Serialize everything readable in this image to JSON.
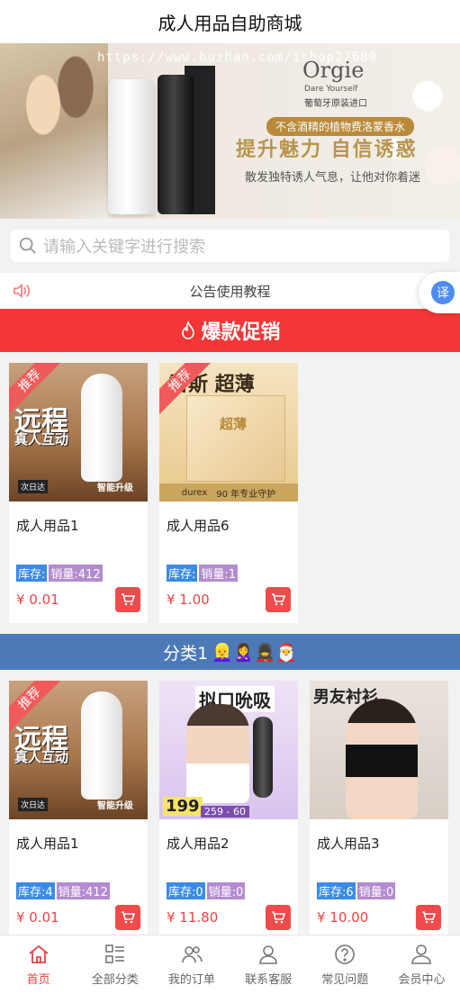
{
  "header": {
    "title": "成人用品自助商城"
  },
  "banner": {
    "watermark": "https://www.huzhan.com/ishop27680",
    "brand": "Orgie",
    "tagline": "Dare Yourself",
    "origin": "葡萄牙原装进口",
    "pill": "不含酒精的植物费洛蒙香水",
    "slogan": "提升魅力 自信诱惑",
    "sub": "散发独特诱人气息，让他对你着迷"
  },
  "search": {
    "placeholder": "请输入关键字进行搜索"
  },
  "notice": {
    "text": "公告使用教程"
  },
  "translate": {
    "label": "译"
  },
  "hot": {
    "title": "爆款促销"
  },
  "hot_products": [
    {
      "name": "成人用品1",
      "stock": "库存:",
      "sold": "销量:412",
      "price": "¥ 0.01",
      "tag": "推荐",
      "img_big": "远程",
      "img_small": "真人互动",
      "img_badge": "次日达",
      "img_upgrade": "智能升级"
    },
    {
      "name": "成人用品6",
      "stock": "库存:",
      "sold": "销量:1",
      "price": "¥ 1.00",
      "tag": "推荐",
      "img_head": "雷斯 超薄",
      "img_box": "超薄",
      "img_foot_brand": "durex",
      "img_foot": "90 年专业守护"
    }
  ],
  "category": {
    "title": "分类1",
    "emoji": "👱‍♀️🙎‍♀️💂‍♀️🎅"
  },
  "cat_products": [
    {
      "name": "成人用品1",
      "stock": "库存:4",
      "sold": "销量:412",
      "price": "¥ 0.01",
      "tag": "推荐",
      "img_big": "远程",
      "img_small": "真人互动",
      "img_badge": "次日达",
      "img_upgrade": "智能升级"
    },
    {
      "name": "成人用品2",
      "stock": "库存:0",
      "sold": "销量:0",
      "price": "¥ 11.80",
      "img_head": "拟口吮吸",
      "img_price": "199",
      "img_calc": "259 - 60"
    },
    {
      "name": "成人用品3",
      "stock": "库存:6",
      "sold": "销量:0",
      "price": "¥ 10.00",
      "img_head": "男友衬衫"
    }
  ],
  "tabbar": [
    {
      "label": "首页",
      "icon": "home-icon"
    },
    {
      "label": "全部分类",
      "icon": "category-icon"
    },
    {
      "label": "我的订单",
      "icon": "orders-icon"
    },
    {
      "label": "联系客服",
      "icon": "service-icon"
    },
    {
      "label": "常见问题",
      "icon": "help-icon"
    },
    {
      "label": "会员中心",
      "icon": "member-icon"
    }
  ],
  "colors": {
    "accent": "#f33636",
    "category_bar": "#4c79b8",
    "stock_badge": "#3a8be6",
    "sold_badge": "#b48bd0"
  }
}
